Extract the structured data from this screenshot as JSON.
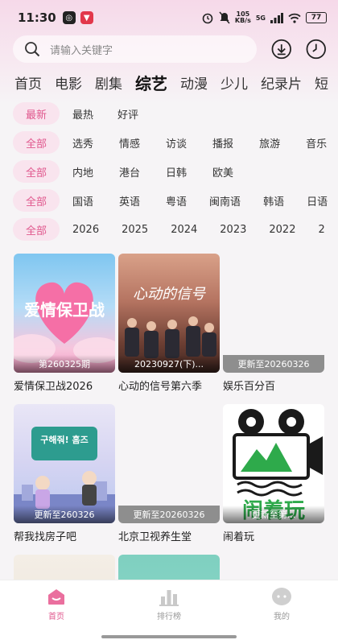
{
  "status_bar": {
    "time": "11:30",
    "network_speed": "105\nKB/s",
    "signal": "5G",
    "battery": "77"
  },
  "search": {
    "placeholder": "请输入关键字"
  },
  "header_icons": [
    "download-icon",
    "history-icon"
  ],
  "category_tabs": [
    {
      "label": "首页",
      "active": false
    },
    {
      "label": "电影",
      "active": false
    },
    {
      "label": "剧集",
      "active": false
    },
    {
      "label": "综艺",
      "active": true
    },
    {
      "label": "动漫",
      "active": false
    },
    {
      "label": "少儿",
      "active": false
    },
    {
      "label": "纪录片",
      "active": false
    },
    {
      "label": "短",
      "active": false
    }
  ],
  "filters": {
    "sort": [
      "最新",
      "最热",
      "好评"
    ],
    "type": [
      "全部",
      "选秀",
      "情感",
      "访谈",
      "播报",
      "旅游",
      "音乐"
    ],
    "region": [
      "全部",
      "内地",
      "港台",
      "日韩",
      "欧美"
    ],
    "language": [
      "全部",
      "国语",
      "英语",
      "粤语",
      "闽南语",
      "韩语",
      "日语"
    ],
    "year": [
      "全部",
      "2026",
      "2025",
      "2024",
      "2023",
      "2022",
      "2"
    ]
  },
  "accent_color": "#e0578d",
  "cards": [
    {
      "title": "爱情保卫战2026",
      "badge": "第260325期",
      "poster_text": "爱情保卫战"
    },
    {
      "title": "心动的信号第六季",
      "badge": "20230927(下)...",
      "poster_text": "心动的信号"
    },
    {
      "title": "娱乐百分百",
      "badge": "更新至20260326",
      "poster_text": ""
    },
    {
      "title": "帮我找房子吧",
      "badge": "更新至260326",
      "poster_text": "구해줘! 홈즈"
    },
    {
      "title": "北京卫视养生堂",
      "badge": "更新至20260326",
      "poster_text": ""
    },
    {
      "title": "闹着玩",
      "badge": "更新至第...",
      "poster_text": "闹着玩"
    }
  ],
  "bottom_nav": [
    {
      "label": "首页",
      "active": true
    },
    {
      "label": "排行榜",
      "active": false
    },
    {
      "label": "我的",
      "active": false
    }
  ]
}
